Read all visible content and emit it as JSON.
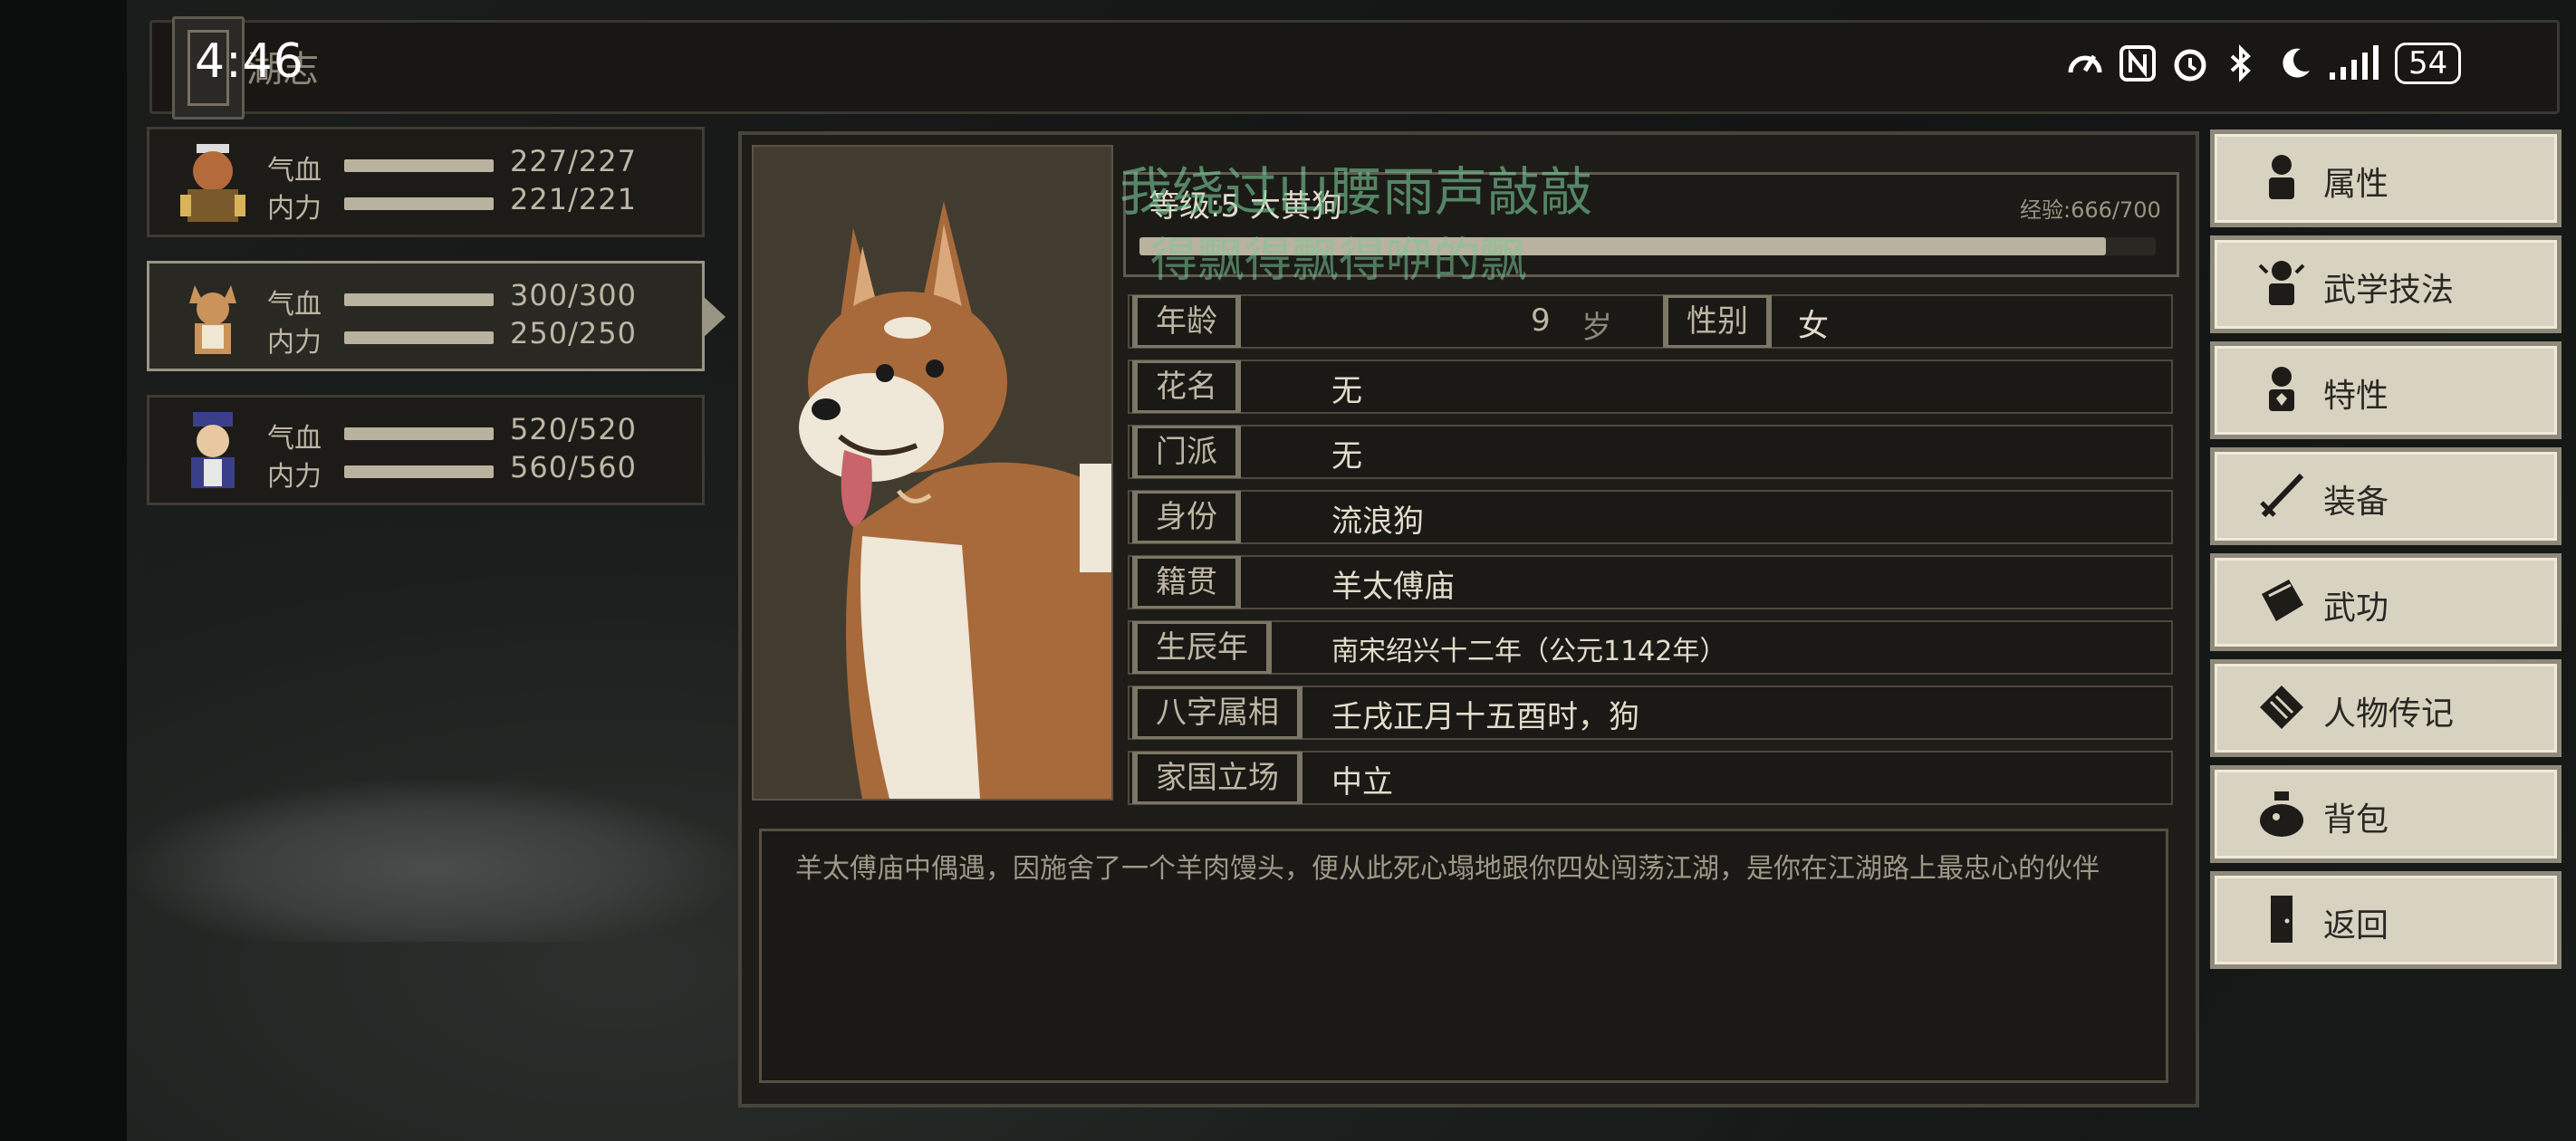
{
  "status_bar": {
    "time": "4:46",
    "battery": "54"
  },
  "window": {
    "title": "湖志"
  },
  "party": [
    {
      "hp_label": "气血",
      "hp": "227/227",
      "mp_label": "内力",
      "mp": "221/221"
    },
    {
      "hp_label": "气血",
      "hp": "300/300",
      "mp_label": "内力",
      "mp": "250/250"
    },
    {
      "hp_label": "气血",
      "hp": "520/520",
      "mp_label": "内力",
      "mp": "560/560"
    }
  ],
  "character": {
    "level_line": "等级:5   大黄狗",
    "exp_text": "经验:666/700",
    "exp_fraction": 0.951,
    "age_label": "年龄",
    "age_value": "9",
    "age_unit": "岁",
    "gender_label": "性别",
    "gender_value": "女",
    "rows": [
      {
        "label": "花名",
        "value": "无"
      },
      {
        "label": "门派",
        "value": "无"
      },
      {
        "label": "身份",
        "value": "流浪狗"
      },
      {
        "label": "籍贯",
        "value": "羊太傅庙"
      },
      {
        "label": "生辰年",
        "value": "南宋绍兴十二年（公元1142年）"
      },
      {
        "label": "八字属相",
        "value": "壬戌正月十五酉时，狗"
      },
      {
        "label": "家国立场",
        "value": "中立"
      }
    ],
    "description": "羊太傅庙中偶遇，因施舍了一个羊肉馒头，便从此死心塌地跟你四处闯荡江湖，是你在江湖路上最忠心的伙伴"
  },
  "overlay_lyrics": [
    "我绕过山腰雨声敲敲",
    "得飘得飘得咿的飘"
  ],
  "menu": [
    {
      "label": "属性",
      "icon": "person-icon"
    },
    {
      "label": "武学技法",
      "icon": "martial-figure-icon"
    },
    {
      "label": "特性",
      "icon": "trait-figure-icon"
    },
    {
      "label": "装备",
      "icon": "sword-icon"
    },
    {
      "label": "武功",
      "icon": "scroll-book-icon"
    },
    {
      "label": "人物传记",
      "icon": "biography-icon"
    },
    {
      "label": "背包",
      "icon": "bag-icon"
    },
    {
      "label": "返回",
      "icon": "door-icon"
    }
  ],
  "colors": {
    "accent": "#b9b29e",
    "button_bg": "#d8d3c0",
    "panel_bg": "#1e1c18"
  }
}
